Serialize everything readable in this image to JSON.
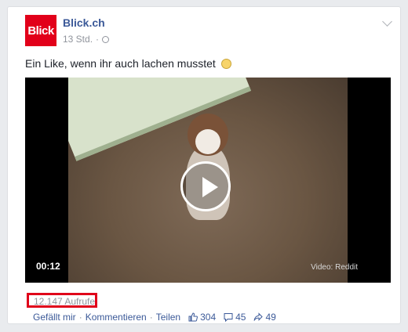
{
  "post": {
    "page_name": "Blick.ch",
    "logo_text": "Blick",
    "time": "13 Std.",
    "status": "Ein Like, wenn ihr auch lachen musstet",
    "video": {
      "duration": "00:12",
      "credit": "Video: Reddit"
    },
    "views": "12.147 Aufrufe",
    "actions": {
      "like": "Gefällt mir",
      "comment": "Kommentieren",
      "share": "Teilen"
    },
    "stats": {
      "likes": "304",
      "comments": "45",
      "shares": "49"
    },
    "colors": {
      "brand": "#e2001a",
      "link": "#3b5998",
      "highlight": "#e0001a"
    }
  }
}
